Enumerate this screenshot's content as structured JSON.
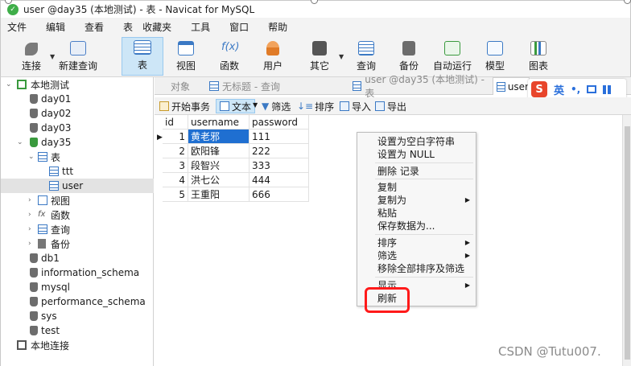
{
  "window": {
    "title": "user @day35 (本地测试) - 表 - Navicat for MySQL"
  },
  "menubar": {
    "items": [
      "文件",
      "编辑",
      "查看",
      "表",
      "收藏夹",
      "工具",
      "窗口",
      "帮助"
    ]
  },
  "toolbar": {
    "buttons": [
      {
        "label": "连接",
        "icon": "plug-icon"
      },
      {
        "label": "新建查询",
        "icon": "new-query-icon"
      },
      {
        "label": "表",
        "icon": "table-icon",
        "active": true
      },
      {
        "label": "视图",
        "icon": "view-icon"
      },
      {
        "label": "函数",
        "icon": "function-icon"
      },
      {
        "label": "用户",
        "icon": "user-icon"
      },
      {
        "label": "其它",
        "icon": "tools-icon"
      },
      {
        "label": "查询",
        "icon": "query-icon"
      },
      {
        "label": "备份",
        "icon": "backup-icon"
      },
      {
        "label": "自动运行",
        "icon": "schedule-icon"
      },
      {
        "label": "模型",
        "icon": "model-icon"
      },
      {
        "label": "图表",
        "icon": "chart-icon"
      }
    ]
  },
  "tree": {
    "items": [
      {
        "label": "本地测试"
      },
      {
        "label": "day01"
      },
      {
        "label": "day02"
      },
      {
        "label": "day03"
      },
      {
        "label": "day35"
      },
      {
        "label": "表"
      },
      {
        "label": "ttt"
      },
      {
        "label": "user"
      },
      {
        "label": "视图"
      },
      {
        "label": "函数"
      },
      {
        "label": "查询"
      },
      {
        "label": "备份"
      },
      {
        "label": "db1"
      },
      {
        "label": "information_schema"
      },
      {
        "label": "mysql"
      },
      {
        "label": "performance_schema"
      },
      {
        "label": "sys"
      },
      {
        "label": "test"
      },
      {
        "label": "本地连接"
      }
    ]
  },
  "tabs": {
    "objects": "对象",
    "untitled": "无标题 - 查询",
    "user_tab": "user @day35 (本地测试) - 表",
    "user_short": "user"
  },
  "ime": {
    "logo": "S",
    "mode": "英",
    "punct": "•,"
  },
  "subtoolbar": {
    "begin_tx": "开始事务",
    "text": "文本",
    "filter": "筛选",
    "sort": "排序",
    "import": "导入",
    "export": "导出"
  },
  "table": {
    "columns": [
      "id",
      "username",
      "password"
    ],
    "rows": [
      {
        "id": "1",
        "username": "黄老邪",
        "password": "111"
      },
      {
        "id": "2",
        "username": "欧阳锋",
        "password": "222"
      },
      {
        "id": "3",
        "username": "段智兴",
        "password": "333"
      },
      {
        "id": "4",
        "username": "洪七公",
        "password": "444"
      },
      {
        "id": "5",
        "username": "王重阳",
        "password": "666"
      }
    ]
  },
  "context_menu": {
    "items": [
      "设置为空白字符串",
      "设置为 NULL",
      "删除 记录",
      "复制",
      "复制为",
      "粘贴",
      "保存数据为...",
      "排序",
      "筛选",
      "移除全部排序及筛选",
      "显示",
      "刷新"
    ]
  },
  "colors": {
    "selection": "#1f6fd1",
    "highlight": "#ff1a1a",
    "active_button": "#cde6f7"
  },
  "watermark": "CSDN @Tutu007."
}
